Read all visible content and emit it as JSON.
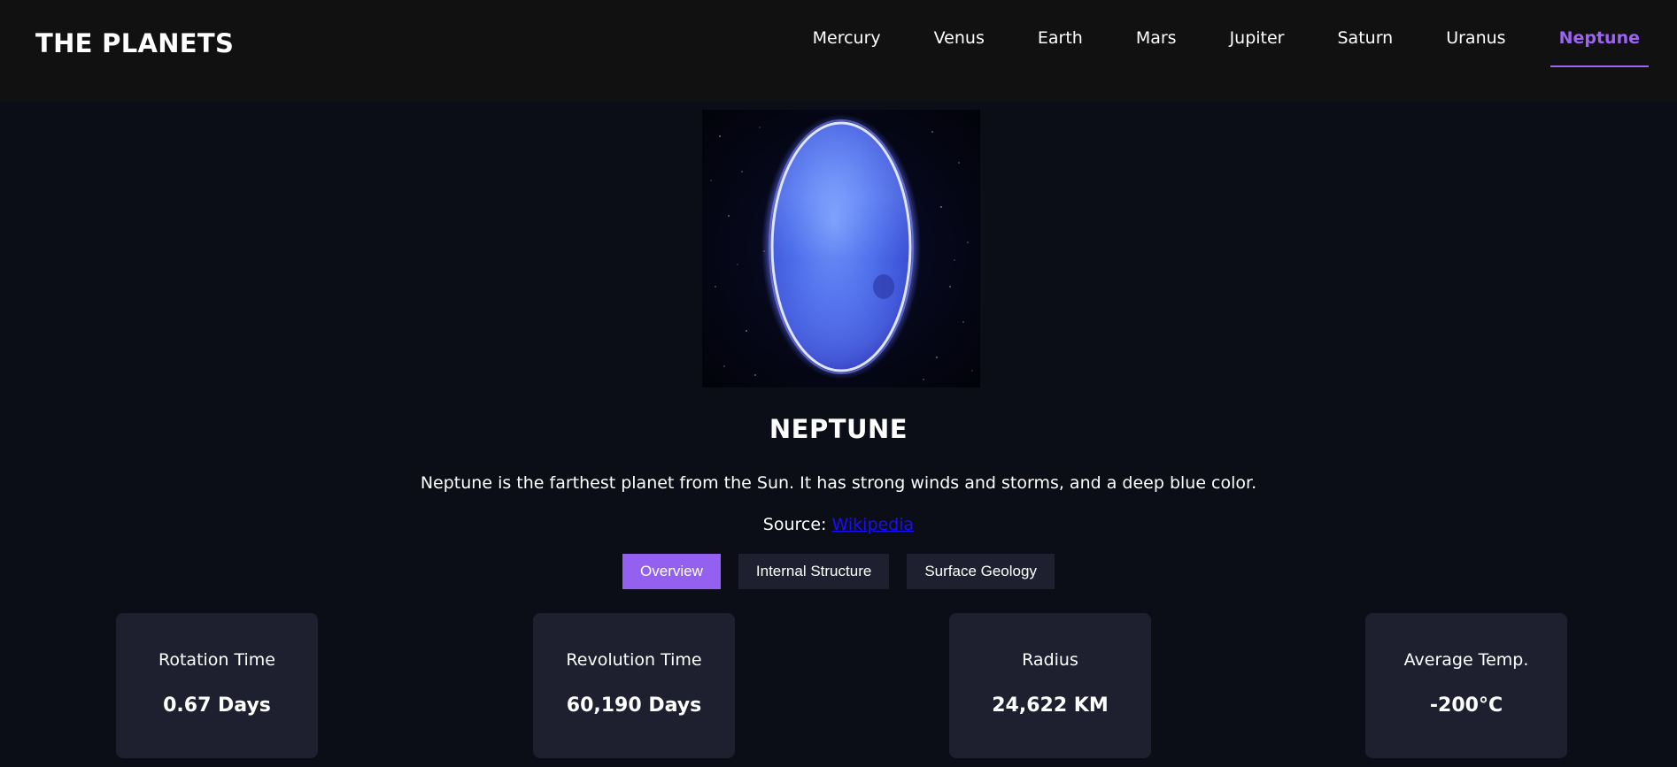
{
  "header": {
    "logo": "THE PLANETS",
    "nav": [
      {
        "label": "Mercury"
      },
      {
        "label": "Venus"
      },
      {
        "label": "Earth"
      },
      {
        "label": "Mars"
      },
      {
        "label": "Jupiter"
      },
      {
        "label": "Saturn"
      },
      {
        "label": "Uranus"
      },
      {
        "label": "Neptune",
        "active": true
      }
    ]
  },
  "planet": {
    "name": "NEPTUNE",
    "description": "Neptune is the farthest planet from the Sun. It has strong winds and storms, and a deep blue color.",
    "source_prefix": "Source:",
    "source_link": "Wikipedia"
  },
  "tabs": [
    {
      "label": "Overview",
      "active": true
    },
    {
      "label": "Internal Structure"
    },
    {
      "label": "Surface Geology"
    }
  ],
  "stats": [
    {
      "label": "Rotation Time",
      "value": "0.67 Days"
    },
    {
      "label": "Revolution Time",
      "value": "60,190 Days"
    },
    {
      "label": "Radius",
      "value": "24,622 KM"
    },
    {
      "label": "Average Temp.",
      "value": "-200°C"
    }
  ],
  "colors": {
    "accent": "#9d63f5",
    "background": "#0b0d17",
    "header_bg": "#111111",
    "card_bg": "#1e2030",
    "link": "#1a0dff"
  }
}
